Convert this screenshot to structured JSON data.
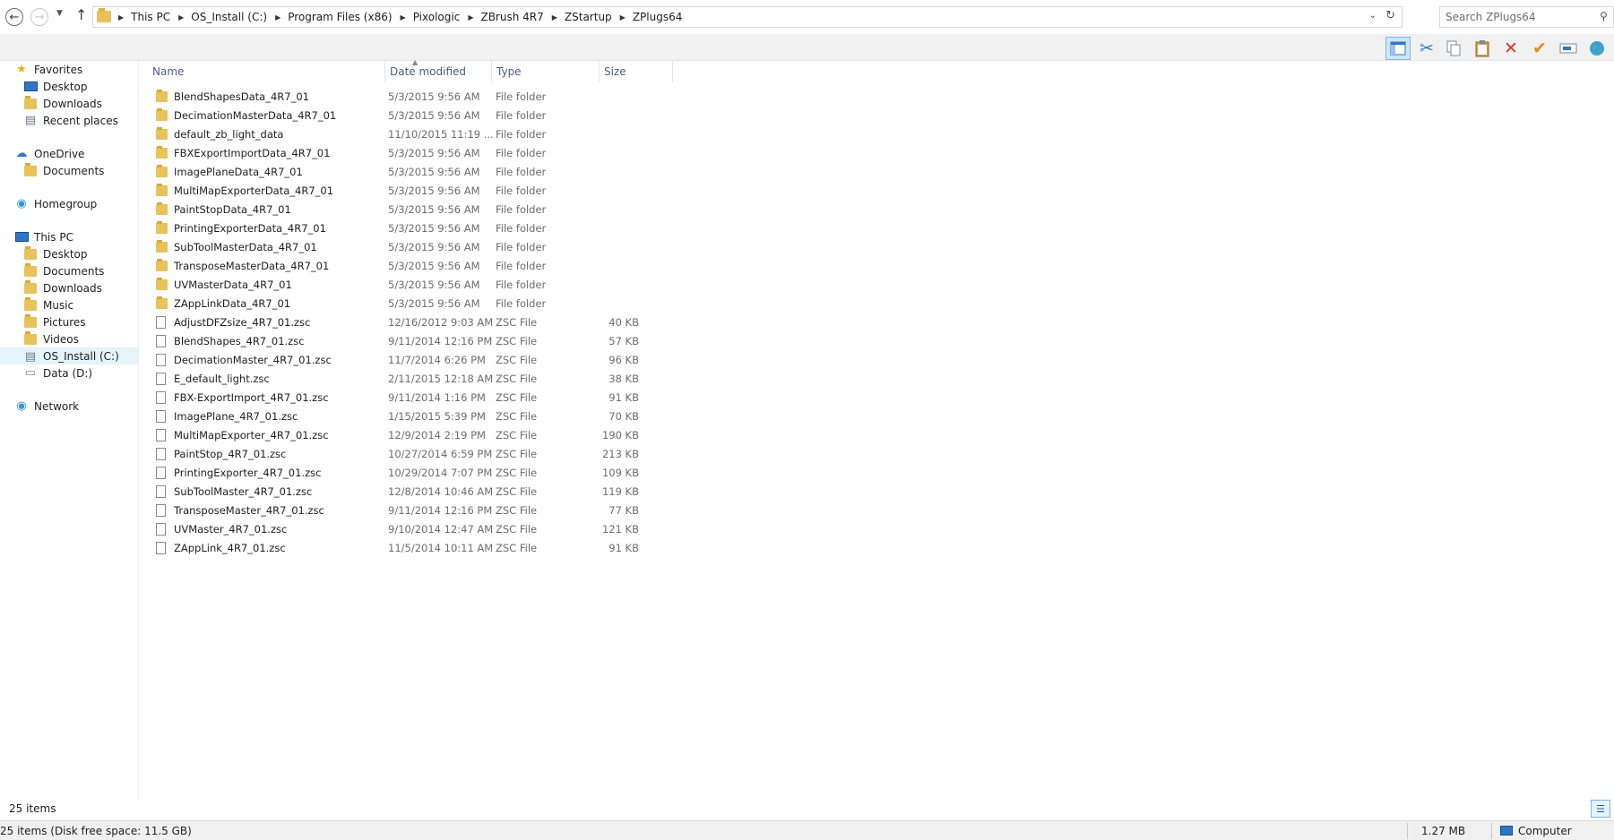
{
  "address": {
    "breadcrumbs": [
      "This PC",
      "OS_Install (C:)",
      "Program Files (x86)",
      "Pixologic",
      "ZBrush 4R7",
      "ZStartup",
      "ZPlugs64"
    ]
  },
  "search": {
    "placeholder": "Search ZPlugs64"
  },
  "toolbar": {
    "icons": [
      "layout-icon",
      "cut-icon",
      "copy-icon",
      "paste-icon",
      "delete-icon",
      "checkmark-icon",
      "rename-icon",
      "globe-icon"
    ],
    "colors": {
      "delete": "#d9362b",
      "check": "#e88a1a",
      "selected": "#cde6f7"
    }
  },
  "nav": {
    "favorites": {
      "label": "Favorites",
      "items": [
        "Desktop",
        "Downloads",
        "Recent places"
      ]
    },
    "onedrive": {
      "label": "OneDrive",
      "items": [
        "Documents"
      ]
    },
    "homegroup": {
      "label": "Homegroup"
    },
    "thispc": {
      "label": "This PC",
      "items": [
        "Desktop",
        "Documents",
        "Downloads",
        "Music",
        "Pictures",
        "Videos",
        "OS_Install (C:)",
        "Data (D:)"
      ]
    },
    "network": {
      "label": "Network"
    }
  },
  "columns": {
    "name": "Name",
    "date": "Date modified",
    "type": "Type",
    "size": "Size"
  },
  "files": [
    {
      "name": "BlendShapesData_4R7_01",
      "date": "5/3/2015 9:56 AM",
      "type": "File folder",
      "size": "",
      "kind": "folder"
    },
    {
      "name": "DecimationMasterData_4R7_01",
      "date": "5/3/2015 9:56 AM",
      "type": "File folder",
      "size": "",
      "kind": "folder"
    },
    {
      "name": "default_zb_light_data",
      "date": "11/10/2015 11:19 ...",
      "type": "File folder",
      "size": "",
      "kind": "folder"
    },
    {
      "name": "FBXExportImportData_4R7_01",
      "date": "5/3/2015 9:56 AM",
      "type": "File folder",
      "size": "",
      "kind": "folder"
    },
    {
      "name": "ImagePlaneData_4R7_01",
      "date": "5/3/2015 9:56 AM",
      "type": "File folder",
      "size": "",
      "kind": "folder"
    },
    {
      "name": "MultiMapExporterData_4R7_01",
      "date": "5/3/2015 9:56 AM",
      "type": "File folder",
      "size": "",
      "kind": "folder"
    },
    {
      "name": "PaintStopData_4R7_01",
      "date": "5/3/2015 9:56 AM",
      "type": "File folder",
      "size": "",
      "kind": "folder"
    },
    {
      "name": "PrintingExporterData_4R7_01",
      "date": "5/3/2015 9:56 AM",
      "type": "File folder",
      "size": "",
      "kind": "folder"
    },
    {
      "name": "SubToolMasterData_4R7_01",
      "date": "5/3/2015 9:56 AM",
      "type": "File folder",
      "size": "",
      "kind": "folder"
    },
    {
      "name": "TransposeMasterData_4R7_01",
      "date": "5/3/2015 9:56 AM",
      "type": "File folder",
      "size": "",
      "kind": "folder"
    },
    {
      "name": "UVMasterData_4R7_01",
      "date": "5/3/2015 9:56 AM",
      "type": "File folder",
      "size": "",
      "kind": "folder"
    },
    {
      "name": "ZAppLinkData_4R7_01",
      "date": "5/3/2015 9:56 AM",
      "type": "File folder",
      "size": "",
      "kind": "folder"
    },
    {
      "name": "AdjustDFZsize_4R7_01.zsc",
      "date": "12/16/2012 9:03 AM",
      "type": "ZSC File",
      "size": "40 KB",
      "kind": "file"
    },
    {
      "name": "BlendShapes_4R7_01.zsc",
      "date": "9/11/2014 12:16 PM",
      "type": "ZSC File",
      "size": "57 KB",
      "kind": "file"
    },
    {
      "name": "DecimationMaster_4R7_01.zsc",
      "date": "11/7/2014 6:26 PM",
      "type": "ZSC File",
      "size": "96 KB",
      "kind": "file"
    },
    {
      "name": "E_default_light.zsc",
      "date": "2/11/2015 12:18 AM",
      "type": "ZSC File",
      "size": "38 KB",
      "kind": "file"
    },
    {
      "name": "FBX-ExportImport_4R7_01.zsc",
      "date": "9/11/2014 1:16 PM",
      "type": "ZSC File",
      "size": "91 KB",
      "kind": "file"
    },
    {
      "name": "ImagePlane_4R7_01.zsc",
      "date": "1/15/2015 5:39 PM",
      "type": "ZSC File",
      "size": "70 KB",
      "kind": "file"
    },
    {
      "name": "MultiMapExporter_4R7_01.zsc",
      "date": "12/9/2014 2:19 PM",
      "type": "ZSC File",
      "size": "190 KB",
      "kind": "file"
    },
    {
      "name": "PaintStop_4R7_01.zsc",
      "date": "10/27/2014 6:59 PM",
      "type": "ZSC File",
      "size": "213 KB",
      "kind": "file"
    },
    {
      "name": "PrintingExporter_4R7_01.zsc",
      "date": "10/29/2014 7:07 PM",
      "type": "ZSC File",
      "size": "109 KB",
      "kind": "file"
    },
    {
      "name": "SubToolMaster_4R7_01.zsc",
      "date": "12/8/2014 10:46 AM",
      "type": "ZSC File",
      "size": "119 KB",
      "kind": "file"
    },
    {
      "name": "TransposeMaster_4R7_01.zsc",
      "date": "9/11/2014 12:16 PM",
      "type": "ZSC File",
      "size": "77 KB",
      "kind": "file"
    },
    {
      "name": "UVMaster_4R7_01.zsc",
      "date": "9/10/2014 12:47 AM",
      "type": "ZSC File",
      "size": "121 KB",
      "kind": "file"
    },
    {
      "name": "ZAppLink_4R7_01.zsc",
      "date": "11/5/2014 10:11 AM",
      "type": "ZSC File",
      "size": "91 KB",
      "kind": "file"
    }
  ],
  "status": {
    "items": "25 items",
    "bar_text": "25 items (Disk free space: 11.5 GB)",
    "size": "1.27 MB",
    "location": "Computer"
  }
}
